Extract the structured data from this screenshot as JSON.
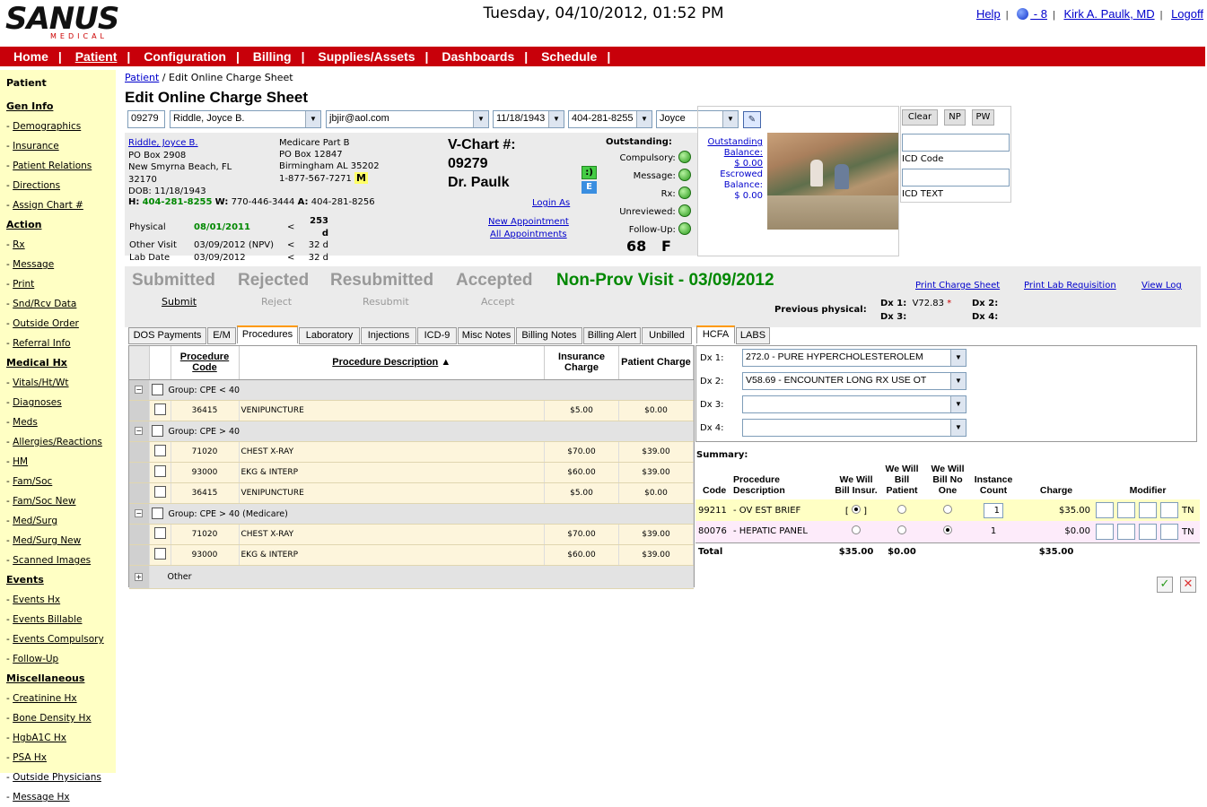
{
  "header": {
    "logo_word": "SANUS",
    "logo_sub": "MEDICAL",
    "datetime": "Tuesday, 04/10/2012, 01:52 PM",
    "help": "Help",
    "messages": " - 8",
    "user": "Kirk A. Paulk, MD",
    "logoff": "Logoff"
  },
  "nav": [
    "Home",
    "Patient",
    "Configuration",
    "Billing",
    "Supplies/Assets",
    "Dashboards",
    "Schedule"
  ],
  "sidebar": {
    "title": "Patient",
    "sections": [
      {
        "name": "Gen Info",
        "items": [
          "Demographics",
          "Insurance",
          "Patient Relations",
          "Directions",
          "Assign Chart #"
        ]
      },
      {
        "name": "Action",
        "items": [
          "Rx",
          "Message",
          "Print",
          "Snd/Rcv Data",
          "Outside Order",
          "Referral Info"
        ]
      },
      {
        "name": "Medical Hx",
        "items": [
          "Vitals/Ht/Wt",
          "Diagnoses",
          "Meds",
          "Allergies/Reactions",
          "HM",
          "Fam/Soc",
          "Fam/Soc New",
          "Med/Surg",
          "Med/Surg New",
          "Scanned Images"
        ]
      },
      {
        "name": "Events",
        "items": [
          "Events Hx",
          "Events Billable",
          "Events Compulsory",
          "Follow-Up"
        ]
      },
      {
        "name": "Miscellaneous",
        "items": [
          "Creatinine Hx",
          "Bone Density Hx",
          "HgbA1C Hx",
          "PSA Hx",
          "Outside Physicians",
          "Message Hx"
        ]
      }
    ]
  },
  "breadcrumb": {
    "link": "Patient",
    "rest": " / Edit Online Charge Sheet"
  },
  "page_title": "Edit Online Charge Sheet",
  "search": {
    "chart": "09279",
    "name": "Riddle, Joyce B.",
    "email": "jbjir@aol.com",
    "dob": "11/18/1943",
    "phone": "404-281-8255",
    "first": "Joyce"
  },
  "patient": {
    "name": "Riddle, Joyce B.",
    "addr1": "PO Box 2908",
    "addr2": "New Smyrna Beach, FL",
    "zip": "32170",
    "dob": "DOB: 11/18/1943",
    "ins_name": "Medicare Part B",
    "ins_addr1": "PO Box 12847",
    "ins_addr2": "Birmingham AL 35202",
    "ins_phone": "1-877-567-7271",
    "ins_badge": "M",
    "h_label": "H:",
    "h_phone": "404-281-8255",
    "w_label": "W:",
    "w_phone": "770-446-3444",
    "a_label": "A:",
    "a_phone": "404-281-8256",
    "vchart_label": "V-Chart #:",
    "vchart": "09279",
    "doctor": "Dr. Paulk",
    "smiley": ":)",
    "e_badge": "E",
    "login_as": "Login As",
    "new_appt": "New Appointment",
    "all_appts": "All Appointments",
    "visits": [
      {
        "label": "Physical",
        "date": "08/01/2011",
        "cmp": "<",
        "days": "253 d"
      },
      {
        "label": "Other Visit",
        "date": "03/09/2012 (NPV)",
        "cmp": "<",
        "days": "32 d"
      },
      {
        "label": "Lab Date",
        "date": "03/09/2012",
        "cmp": "<",
        "days": "32 d"
      }
    ],
    "outstanding_title": "Outstanding:",
    "outstanding": [
      "Compulsory:",
      "Message:",
      "Rx:",
      "Unreviewed:",
      "Follow-Up:"
    ],
    "age": "68",
    "sex": "F",
    "out_balance_label": "Outstanding Balance:",
    "out_balance": "$ 0.00",
    "esc_balance_label": "Escrowed Balance:",
    "esc_balance": "$ 0.00"
  },
  "right_panel": {
    "clear": "Clear",
    "np": "NP",
    "pw": "PW",
    "icd_code": "ICD Code",
    "icd_text": "ICD TEXT"
  },
  "status": {
    "steps": [
      {
        "title": "Submitted",
        "action": "Submit"
      },
      {
        "title": "Rejected",
        "action": "Reject"
      },
      {
        "title": "Resubmitted",
        "action": "Resubmit"
      },
      {
        "title": "Accepted",
        "action": "Accept"
      }
    ],
    "visit": "Non-Prov Visit - 03/09/2012",
    "print_charge": "Print Charge Sheet",
    "print_lab": "Print Lab Requisition",
    "view_log": "View Log",
    "prev_physical": "Previous physical:",
    "dx1_label": "Dx 1:",
    "dx1": "V72.83",
    "dx2_label": "Dx 2:",
    "dx3_label": "Dx 3:",
    "dx4_label": "Dx 4:"
  },
  "tabs_left": [
    "DOS Payments",
    "E/M",
    "Procedures",
    "Laboratory",
    "Injections",
    "ICD-9",
    "Misc Notes",
    "Billing Notes",
    "Billing Alert",
    "Unbilled"
  ],
  "tabs_right": [
    "HCFA",
    "LABS"
  ],
  "grid": {
    "headers": [
      "Procedure Code",
      "Procedure Description",
      "Insurance Charge",
      "Patient Charge"
    ],
    "sort_arrow": "▲",
    "groups": [
      {
        "name": "Group: CPE < 40",
        "rows": [
          [
            "36415",
            "VENIPUNCTURE",
            "$5.00",
            "$0.00"
          ]
        ]
      },
      {
        "name": "Group: CPE > 40",
        "rows": [
          [
            "71020",
            "CHEST X-RAY",
            "$70.00",
            "$39.00"
          ],
          [
            "93000",
            "EKG & INTERP",
            "$60.00",
            "$39.00"
          ],
          [
            "36415",
            "VENIPUNCTURE",
            "$5.00",
            "$0.00"
          ]
        ]
      },
      {
        "name": "Group: CPE > 40 (Medicare)",
        "rows": [
          [
            "71020",
            "CHEST X-RAY",
            "$70.00",
            "$39.00"
          ],
          [
            "93000",
            "EKG & INTERP",
            "$60.00",
            "$39.00"
          ]
        ]
      }
    ],
    "other": "Other"
  },
  "hcfa": {
    "dx": [
      {
        "label": "Dx 1:",
        "value": "272.0 - PURE HYPERCHOLESTEROLEM"
      },
      {
        "label": "Dx 2:",
        "value": "V58.69 - ENCOUNTER LONG RX USE OT"
      },
      {
        "label": "Dx 3:",
        "value": ""
      },
      {
        "label": "Dx 4:",
        "value": ""
      }
    ]
  },
  "summary": {
    "title": "Summary:",
    "headers": [
      "Code",
      "Procedure Description",
      "We Will Bill Insur.",
      "We Will Bill Patient",
      "We Will Bill No One",
      "Instance Count",
      "Charge",
      "Modifier"
    ],
    "rows": [
      {
        "code": "99211",
        "desc": " - OV EST BRIEF",
        "sel": 0,
        "count": "1",
        "charge": "$35.00",
        "mod": "TN"
      },
      {
        "code": "80076",
        "desc": " - HEPATIC PANEL",
        "sel": 2,
        "count": "1",
        "charge": "$0.00",
        "mod": "TN"
      }
    ],
    "total_label": "Total",
    "total_ins": "$35.00",
    "total_pat": "$0.00",
    "total_charge": "$35.00"
  },
  "colors": {
    "nav_bg": "#c8000a",
    "sidebar_bg": "#ffffc4",
    "green_text": "#008000",
    "row_yellow": "#fdf5dc",
    "row_pink": "#fdebfa"
  }
}
